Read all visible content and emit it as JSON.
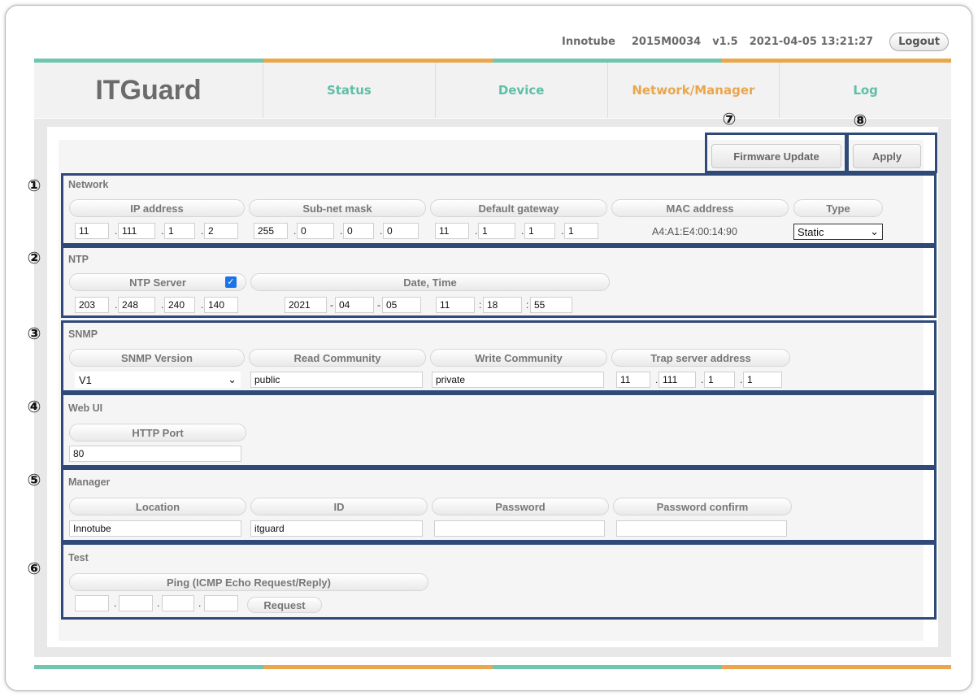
{
  "header": {
    "brand": "Innotube",
    "serial": "2015M0034",
    "version": "v1.5",
    "datetime": "2021-04-05 13:21:27",
    "logout_label": "Logout"
  },
  "nav": {
    "logo": "ITGuard",
    "tabs": [
      "Status",
      "Device",
      "Network/Manager",
      "Log"
    ],
    "active": "Network/Manager"
  },
  "markers": [
    "①",
    "②",
    "③",
    "④",
    "⑤",
    "⑥",
    "⑦",
    "⑧"
  ],
  "buttons": {
    "firmware_update": "Firmware Update",
    "apply": "Apply"
  },
  "network": {
    "title": "Network",
    "labels": [
      "IP address",
      "Sub-net mask",
      "Default gateway",
      "MAC address",
      "Type"
    ],
    "ip": [
      "11",
      "111",
      "1",
      "2"
    ],
    "subnet": [
      "255",
      "0",
      "0",
      "0"
    ],
    "gateway": [
      "11",
      "1",
      "1",
      "1"
    ],
    "mac": "A4:A1:E4:00:14:90",
    "type": "Static"
  },
  "ntp": {
    "title": "NTP",
    "labels": [
      "NTP Server",
      "Date, Time"
    ],
    "server_enabled": true,
    "server": [
      "203",
      "248",
      "240",
      "140"
    ],
    "date": [
      "2021",
      "04",
      "05"
    ],
    "time": [
      "11",
      "18",
      "55"
    ]
  },
  "snmp": {
    "title": "SNMP",
    "labels": [
      "SNMP Version",
      "Read Community",
      "Write Community",
      "Trap server address"
    ],
    "version": "V1",
    "read_community": "public",
    "write_community": "private",
    "trap": [
      "11",
      "111",
      "1",
      "1"
    ]
  },
  "webui": {
    "title": "Web UI",
    "labels": [
      "HTTP Port"
    ],
    "http_port": "80"
  },
  "manager": {
    "title": "Manager",
    "labels": [
      "Location",
      "ID",
      "Password",
      "Password confirm"
    ],
    "location": "Innotube",
    "id": "itguard",
    "password": "",
    "password_confirm": ""
  },
  "test": {
    "title": "Test",
    "labels": [
      "Ping (ICMP Echo Request/Reply)"
    ],
    "ping": [
      "",
      "",
      "",
      ""
    ],
    "request_label": "Request"
  },
  "colors": {
    "teal": "#6ec6b0",
    "orange": "#eaa64a",
    "box_border": "#2f4a78"
  }
}
